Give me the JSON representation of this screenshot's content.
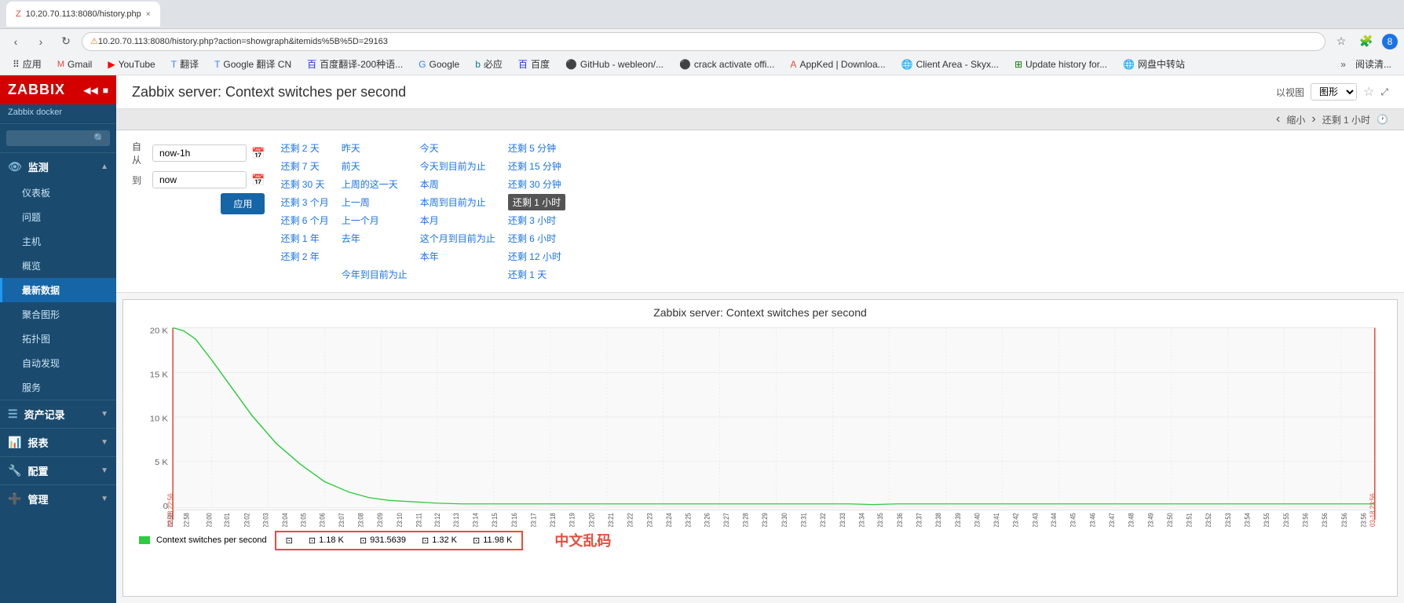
{
  "browser": {
    "tab_title": "10.20.70.113:8080/history.php",
    "address": "10.20.70.113:8080/history.php?action=showgraph&itemids%5B%5D=29163",
    "warning_text": "不安全",
    "bookmarks": [
      {
        "label": "应用",
        "icon": "grid"
      },
      {
        "label": "Gmail",
        "icon": "gmail"
      },
      {
        "label": "YouTube",
        "icon": "youtube"
      },
      {
        "label": "翻译",
        "icon": "translate"
      },
      {
        "label": "Google 翻译 CN",
        "icon": "translate2"
      },
      {
        "label": "百度翻译-200种语...",
        "icon": "baidu"
      },
      {
        "label": "Google",
        "icon": "google"
      },
      {
        "label": "必应",
        "icon": "bing"
      },
      {
        "label": "百度",
        "icon": "baidu2"
      },
      {
        "label": "GitHub - webleon/...",
        "icon": "github"
      },
      {
        "label": "crack activate offi...",
        "icon": "github2"
      },
      {
        "label": "AppKed | Downloa...",
        "icon": "appked"
      },
      {
        "label": "Client Area - Skyx...",
        "icon": "client"
      },
      {
        "label": "Update history for...",
        "icon": "update"
      },
      {
        "label": "网盘中转站",
        "icon": "disk"
      },
      {
        "label": "阅读清...",
        "icon": "read"
      }
    ]
  },
  "sidebar": {
    "logo": "ZABBIX",
    "subtitle": "Zabbix docker",
    "search_placeholder": "",
    "sections": [
      {
        "id": "monitoring",
        "icon": "👁",
        "label": "监测",
        "expanded": true,
        "items": [
          {
            "label": "仪表板",
            "active": false
          },
          {
            "label": "问题",
            "active": false
          },
          {
            "label": "主机",
            "active": false
          },
          {
            "label": "概览",
            "active": false
          },
          {
            "label": "最新数据",
            "active": true
          },
          {
            "label": "聚合图形",
            "active": false
          },
          {
            "label": "拓扑图",
            "active": false
          },
          {
            "label": "自动发现",
            "active": false
          },
          {
            "label": "服务",
            "active": false
          }
        ]
      },
      {
        "id": "assets",
        "icon": "☰",
        "label": "资产记录",
        "expanded": false,
        "items": []
      },
      {
        "id": "reports",
        "icon": "📊",
        "label": "报表",
        "expanded": false,
        "items": []
      },
      {
        "id": "config",
        "icon": "🔧",
        "label": "配置",
        "expanded": false,
        "items": []
      },
      {
        "id": "admin",
        "icon": "➕",
        "label": "管理",
        "expanded": false,
        "items": []
      }
    ]
  },
  "page": {
    "title": "Zabbix server: Context switches per second",
    "view_label": "以视图",
    "view_option": "图形",
    "star_icon": "☆"
  },
  "time_filter": {
    "from_label": "自从",
    "from_value": "now-1h",
    "to_label": "到",
    "to_value": "now",
    "apply_label": "应用",
    "shortcuts": [
      [
        "还剩 2 天",
        "昨天",
        "今天",
        "还剩 5 分钟"
      ],
      [
        "还剩 7 天",
        "前天",
        "今天到目前为止",
        "还剩 15 分钟"
      ],
      [
        "还剩 30 天",
        "上周的这一天",
        "本周",
        "还剩 30 分钟"
      ],
      [
        "还剩 3 个月",
        "上一周",
        "本周到目前为止",
        "还剩 1 小时"
      ],
      [
        "还剩 6 个月",
        "上一个月",
        "本月",
        "还剩 3 小时"
      ],
      [
        "还剩 1 年",
        "去年",
        "这个月到目前为止",
        "还剩 6 小时"
      ],
      [
        "还剩 2 年",
        "",
        "本年",
        "还剩 12 小时"
      ],
      [
        "",
        "今年到目前为止",
        "",
        "还剩 1 天"
      ]
    ]
  },
  "time_nav": {
    "shrink_label": "缩小",
    "current_time": "还剩 1 小时",
    "clock_icon": "🕐"
  },
  "graph": {
    "title": "Zabbix server: Context switches per second",
    "y_labels": [
      "20 K",
      "15 K",
      "10 K",
      "5 K",
      "0"
    ],
    "x_start_red": "03-18 22:56",
    "x_end_red": "03-18 23:56",
    "legend_label": "Context switches per second",
    "stats": [
      {
        "icon": "▣",
        "value": ""
      },
      {
        "icon": "▣",
        "value": "1.18 K"
      },
      {
        "icon": "▣",
        "value": "931.5639"
      },
      {
        "icon": "▣",
        "value": "1.32 K"
      },
      {
        "icon": "▣",
        "value": "11.98 K"
      }
    ],
    "garbled": "中文乱码"
  }
}
